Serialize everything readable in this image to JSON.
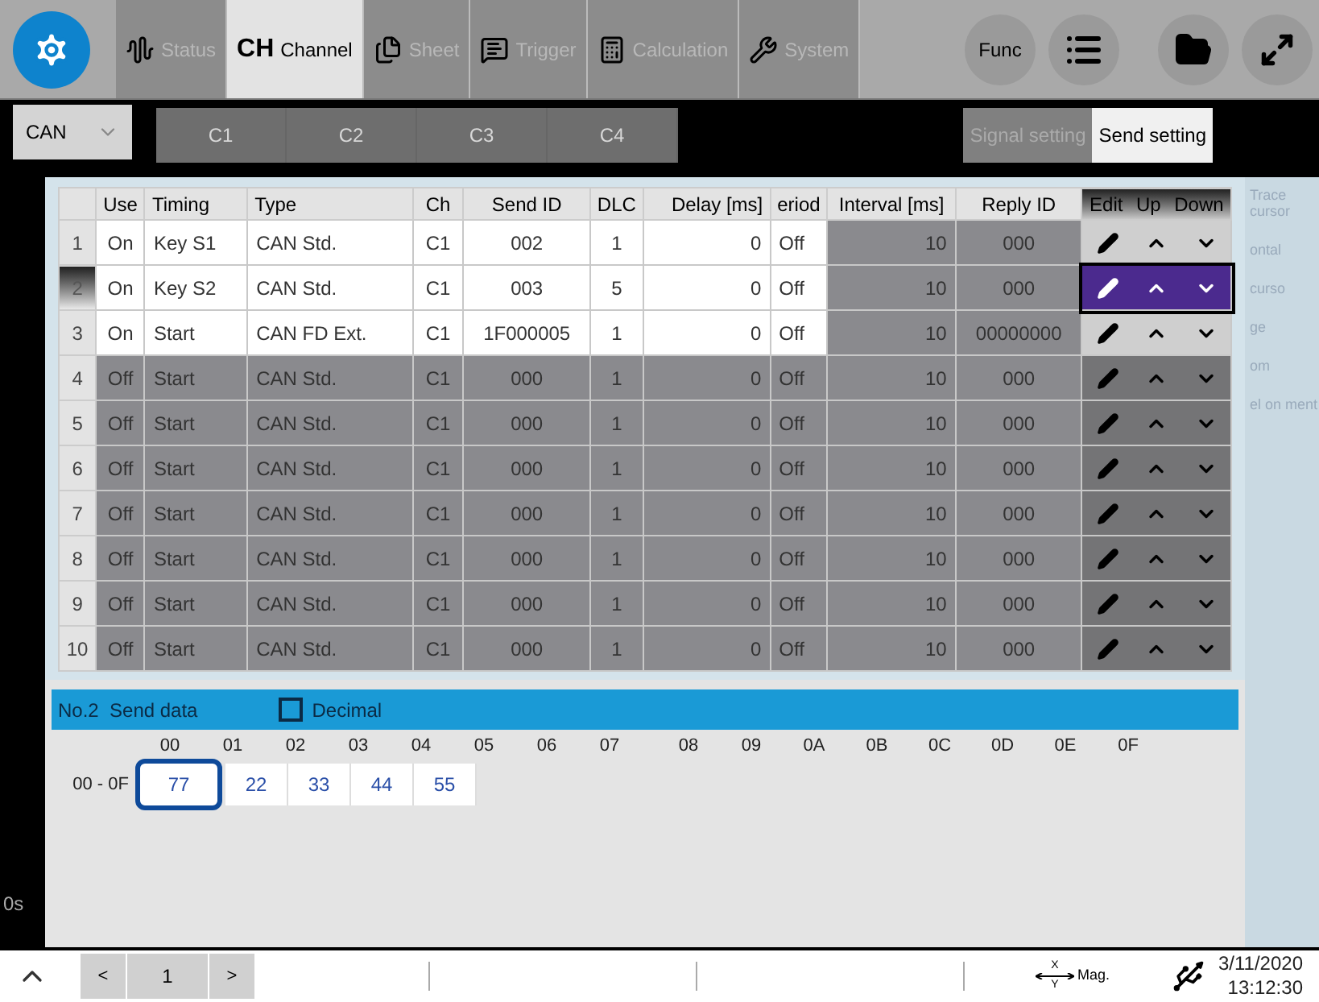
{
  "top_tabs": [
    {
      "kind": "status",
      "label": "Status",
      "selected": false
    },
    {
      "kind": "channel",
      "mark": "CH",
      "label": "Channel",
      "selected": true
    },
    {
      "kind": "sheet",
      "label": "Sheet",
      "selected": false
    },
    {
      "kind": "trigger",
      "label": "Trigger",
      "selected": false
    },
    {
      "kind": "calculation",
      "label": "Calculation",
      "selected": false
    },
    {
      "kind": "system",
      "label": "System",
      "selected": false
    }
  ],
  "round_buttons": [
    {
      "kind": "func",
      "label": "Func"
    },
    {
      "kind": "list"
    },
    {
      "kind": "folder"
    },
    {
      "kind": "expand"
    }
  ],
  "channel_bar": {
    "dropdown": "CAN",
    "channels": [
      "C1",
      "C2",
      "C3",
      "C4"
    ],
    "tabs": [
      {
        "label": "Signal setting",
        "selected": false
      },
      {
        "label": "Send setting",
        "selected": true
      }
    ]
  },
  "side_items": [
    "Trace cursor",
    "ontal",
    "curso",
    "ge",
    "om",
    "el on ment"
  ],
  "time_label": "0s",
  "table": {
    "columns": [
      "",
      "Use",
      "Timing",
      "Type",
      "Ch",
      "Send ID",
      "DLC",
      "Delay [ms]",
      "eriod",
      "Interval [ms]",
      "Reply ID",
      "Edit",
      "Up",
      "Down"
    ],
    "rows": [
      {
        "no": "1",
        "use": "On",
        "enabled": true,
        "selected": false,
        "timing": "Key S1",
        "type": "CAN Std.",
        "ch": "C1",
        "send_id": "002",
        "dlc": "1",
        "delay": "0",
        "period": "Off",
        "interval": "10",
        "reply_id": "000"
      },
      {
        "no": "2",
        "use": "On",
        "enabled": true,
        "selected": true,
        "timing": "Key S2",
        "type": "CAN Std.",
        "ch": "C1",
        "send_id": "003",
        "dlc": "5",
        "delay": "0",
        "period": "Off",
        "interval": "10",
        "reply_id": "000"
      },
      {
        "no": "3",
        "use": "On",
        "enabled": true,
        "selected": false,
        "timing": "Start",
        "type": "CAN FD Ext.",
        "ch": "C1",
        "send_id": "1F000005",
        "dlc": "1",
        "delay": "0",
        "period": "Off",
        "interval": "10",
        "reply_id": "00000000"
      },
      {
        "no": "4",
        "use": "Off",
        "enabled": false,
        "selected": false,
        "timing": "Start",
        "type": "CAN Std.",
        "ch": "C1",
        "send_id": "000",
        "dlc": "1",
        "delay": "0",
        "period": "Off",
        "interval": "10",
        "reply_id": "000"
      },
      {
        "no": "5",
        "use": "Off",
        "enabled": false,
        "selected": false,
        "timing": "Start",
        "type": "CAN Std.",
        "ch": "C1",
        "send_id": "000",
        "dlc": "1",
        "delay": "0",
        "period": "Off",
        "interval": "10",
        "reply_id": "000"
      },
      {
        "no": "6",
        "use": "Off",
        "enabled": false,
        "selected": false,
        "timing": "Start",
        "type": "CAN Std.",
        "ch": "C1",
        "send_id": "000",
        "dlc": "1",
        "delay": "0",
        "period": "Off",
        "interval": "10",
        "reply_id": "000"
      },
      {
        "no": "7",
        "use": "Off",
        "enabled": false,
        "selected": false,
        "timing": "Start",
        "type": "CAN Std.",
        "ch": "C1",
        "send_id": "000",
        "dlc": "1",
        "delay": "0",
        "period": "Off",
        "interval": "10",
        "reply_id": "000"
      },
      {
        "no": "8",
        "use": "Off",
        "enabled": false,
        "selected": false,
        "timing": "Start",
        "type": "CAN Std.",
        "ch": "C1",
        "send_id": "000",
        "dlc": "1",
        "delay": "0",
        "period": "Off",
        "interval": "10",
        "reply_id": "000"
      },
      {
        "no": "9",
        "use": "Off",
        "enabled": false,
        "selected": false,
        "timing": "Start",
        "type": "CAN Std.",
        "ch": "C1",
        "send_id": "000",
        "dlc": "1",
        "delay": "0",
        "period": "Off",
        "interval": "10",
        "reply_id": "000"
      },
      {
        "no": "10",
        "use": "Off",
        "enabled": false,
        "selected": false,
        "timing": "Start",
        "type": "CAN Std.",
        "ch": "C1",
        "send_id": "000",
        "dlc": "1",
        "delay": "0",
        "period": "Off",
        "interval": "10",
        "reply_id": "000"
      }
    ]
  },
  "send_data": {
    "title": "No.2  Send data",
    "decimal": {
      "label": "Decimal",
      "checked": false
    },
    "columns": [
      "00",
      "01",
      "02",
      "03",
      "04",
      "05",
      "06",
      "07",
      "08",
      "09",
      "0A",
      "0B",
      "0C",
      "0D",
      "0E",
      "0F"
    ],
    "row_label": "00 - 0F",
    "cells": [
      {
        "value": "77",
        "selected": true
      },
      {
        "value": "22",
        "selected": false
      },
      {
        "value": "33",
        "selected": false
      },
      {
        "value": "44",
        "selected": false
      },
      {
        "value": "55",
        "selected": false
      }
    ]
  },
  "status_bar": {
    "page": "1",
    "prev": "<",
    "next": ">",
    "mag": {
      "x": "X",
      "y": "Y",
      "label": "Mag."
    },
    "date": "3/11/2020",
    "time": "13:12:30"
  }
}
